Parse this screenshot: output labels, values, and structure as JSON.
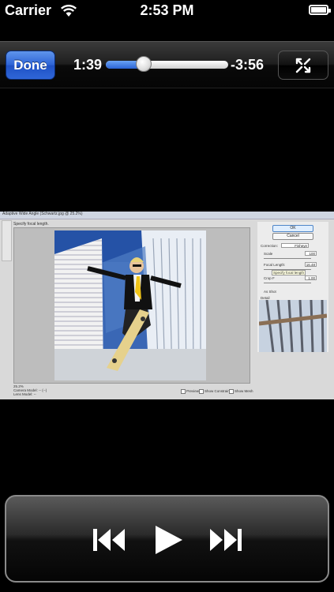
{
  "status_bar": {
    "carrier": "Carrier",
    "time": "2:53 PM"
  },
  "player": {
    "done_label": "Done",
    "elapsed": "1:39",
    "remaining": "-3:56",
    "progress": 0.31
  },
  "video_frame": {
    "dialog_title": "Adaptive Wide Angle (Schwartz.jpg @ 25.2%)",
    "hint": "Specify focal length.",
    "ok_label": "OK",
    "cancel_label": "Cancel",
    "correction_label": "Correction:",
    "correction_value": "Fisheye",
    "scale_label": "Scale",
    "scale_value": "100",
    "focal_length_label": "Focal Length:",
    "focal_length_value": "16.48",
    "tooltip": "Specify focal length",
    "crop_label": "Crop F",
    "crop_value": "1.00",
    "as_shot_label": "As Shot",
    "detail_label": "Detail",
    "zoom_value": "25.2%",
    "camera_model_label": "Camera Model: -- (--)",
    "lens_model_label": "Lens Model: --",
    "preview_label": "Preview",
    "show_constraints_label": "Show Constraints",
    "show_mesh_label": "Show Mesh"
  },
  "icons": {
    "fullscreen": "expand-arrows-icon",
    "previous": "skip-back-icon",
    "play": "play-icon",
    "next": "skip-forward-icon",
    "wifi": "wifi-icon",
    "battery": "battery-icon"
  },
  "colors": {
    "accent": "#2d63d6",
    "background": "#000000"
  }
}
